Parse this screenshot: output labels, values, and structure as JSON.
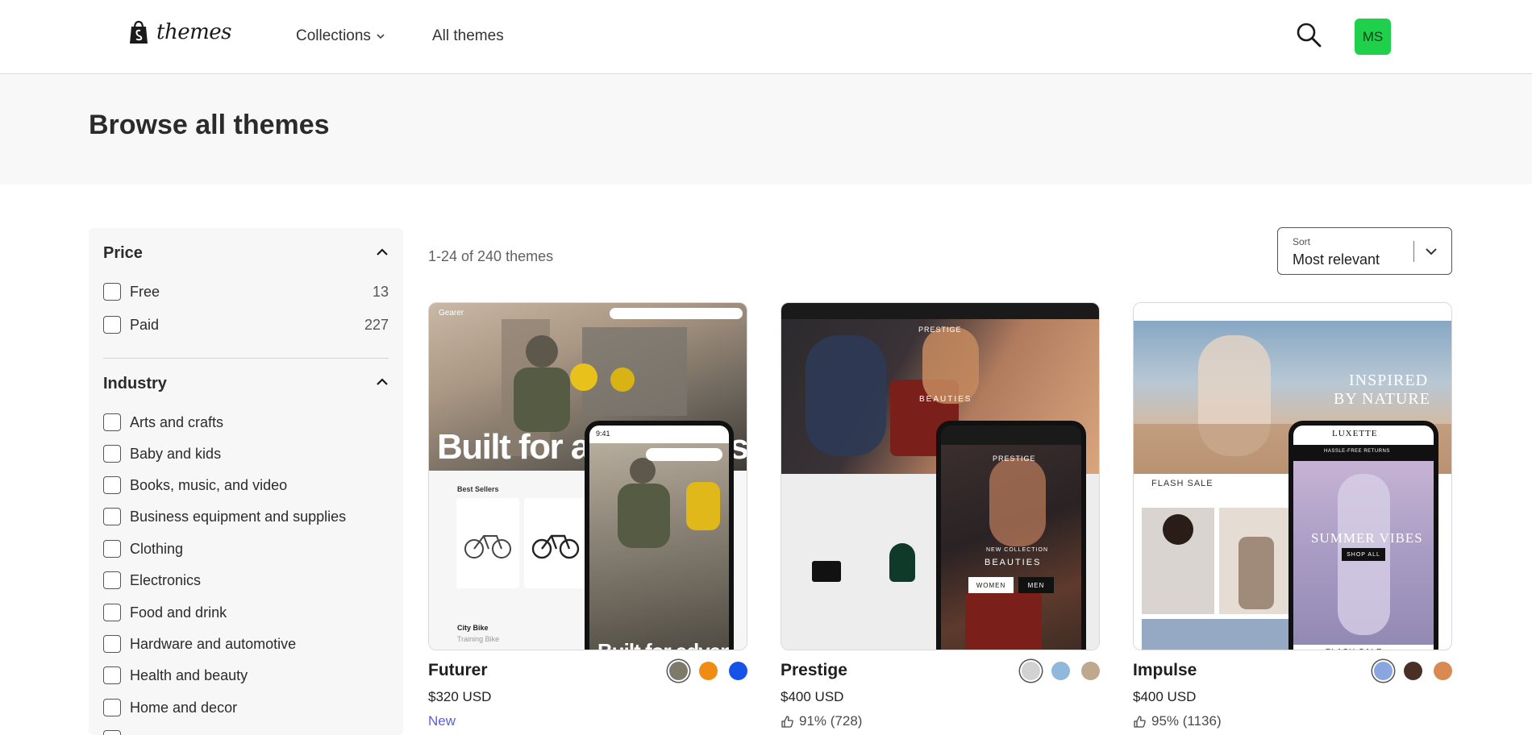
{
  "header": {
    "logo_text": "themes",
    "nav": {
      "collections": "Collections",
      "all_themes": "All themes"
    },
    "avatar_initials": "MS"
  },
  "banner": {
    "title": "Browse all themes"
  },
  "filters": {
    "price": {
      "title": "Price",
      "options": [
        {
          "label": "Free",
          "count": "13"
        },
        {
          "label": "Paid",
          "count": "227"
        }
      ]
    },
    "industry": {
      "title": "Industry",
      "options": [
        {
          "label": "Arts and crafts"
        },
        {
          "label": "Baby and kids"
        },
        {
          "label": "Books, music, and video"
        },
        {
          "label": "Business equipment and supplies"
        },
        {
          "label": "Clothing"
        },
        {
          "label": "Electronics"
        },
        {
          "label": "Food and drink"
        },
        {
          "label": "Hardware and automotive"
        },
        {
          "label": "Health and beauty"
        },
        {
          "label": "Home and decor"
        }
      ]
    }
  },
  "results": {
    "count_text": "1-24 of 240 themes"
  },
  "sort": {
    "label": "Sort",
    "value": "Most relevant"
  },
  "themes": [
    {
      "name": "Futurer",
      "price": "$320 USD",
      "badge": "New",
      "swatches": [
        "#7d7a6b",
        "#f08c14",
        "#1652e8"
      ],
      "preview": {
        "hero_text": "Built for adventures",
        "brand": "Gearer",
        "section": "Best Sellers",
        "category_1": "City Bike",
        "category_2": "Training Bike",
        "time": "9:41"
      }
    },
    {
      "name": "Prestige",
      "price": "$400 USD",
      "rating": "91% (728)",
      "swatches": [
        "#d2d2d2",
        "#8fb8da",
        "#bfa98e"
      ],
      "preview": {
        "brand": "PRESTIGE",
        "collection": "NEW COLLECTION",
        "headline": "BEAUTIES",
        "women": "WOMEN",
        "men": "MEN"
      }
    },
    {
      "name": "Impulse",
      "price": "$400 USD",
      "rating": "95% (1136)",
      "swatches": [
        "#8aa6e0",
        "#4a2f24",
        "#d98a52"
      ],
      "preview": {
        "hero_line1": "INSPIRED",
        "hero_line2": "BY NATURE",
        "brand": "LUXETTE",
        "sale": "FLASH SALE",
        "summer": "SUMMER VIBES",
        "shop_all": "SHOP ALL",
        "returns": "HASSLE-FREE RETURNS"
      }
    }
  ],
  "colors": {
    "accent_green": "#1fd14a",
    "new_badge": "#5a5fd8"
  }
}
